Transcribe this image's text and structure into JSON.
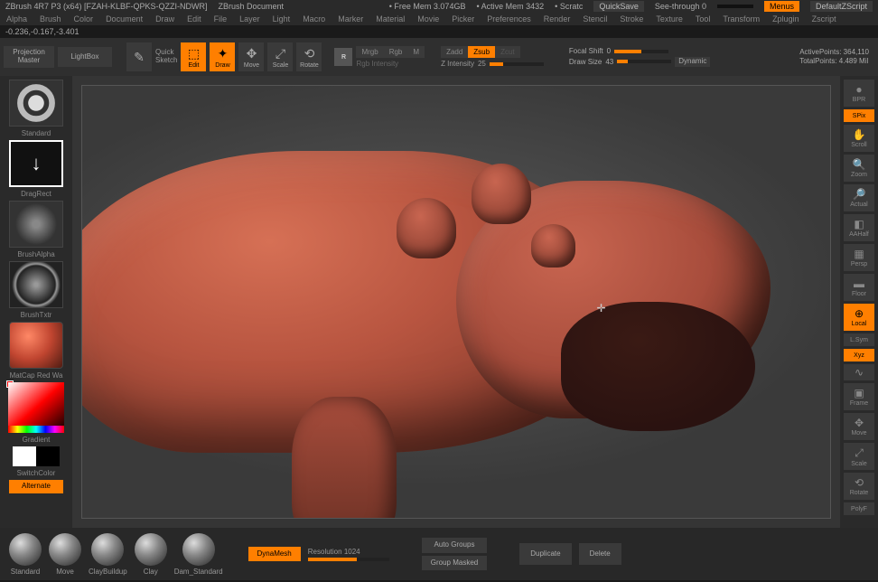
{
  "titlebar": {
    "app": "ZBrush 4R7 P3  (x64) [FZAH-KLBF-QPKS-QZZI-NDWR]",
    "doc": "ZBrush Document",
    "freemem_label": "Free Mem",
    "freemem": "3.074GB",
    "activemem_label": "Active Mem",
    "activemem": "3432",
    "scratch_label": "Scratc",
    "quicksave": "QuickSave",
    "seethrough_label": "See-through",
    "seethrough_val": "0",
    "menus": "Menus",
    "zscript": "DefaultZScript"
  },
  "menu": [
    "Alpha",
    "Brush",
    "Color",
    "Document",
    "Draw",
    "Edit",
    "File",
    "Layer",
    "Light",
    "Macro",
    "Marker",
    "Material",
    "Movie",
    "Picker",
    "Preferences",
    "Render",
    "Stencil",
    "Stroke",
    "Texture",
    "Tool",
    "Transform",
    "Zplugin",
    "Zscript"
  ],
  "coords": "-0.236,-0.167,-3.401",
  "toolbar": {
    "projection": "Projection\nMaster",
    "lightbox": "LightBox",
    "quicksketch": "Quick\nSketch",
    "edit": "Edit",
    "draw": "Draw",
    "move": "Move",
    "scale": "Scale",
    "rotate": "Rotate",
    "mrgb": "Mrgb",
    "rgb": "Rgb",
    "m": "M",
    "rgb_int_label": "Rgb Intensity",
    "zadd": "Zadd",
    "zsub": "Zsub",
    "zcut": "Zcut",
    "zint_label": "Z Intensity",
    "zint_val": "25",
    "focal_label": "Focal Shift",
    "focal_val": "0",
    "drawsize_label": "Draw Size",
    "drawsize_val": "43",
    "dynamic": "Dynamic",
    "activepoints_label": "ActivePoints:",
    "activepoints": "364,110",
    "totalpoints_label": "TotalPoints:",
    "totalpoints": "4.489 Mil"
  },
  "left": {
    "standard": "Standard",
    "dragrect": "DragRect",
    "brushalpha": "BrushAlpha",
    "brushtxtr": "BrushTxtr",
    "matcap": "MatCap Red Wa",
    "gradient": "Gradient",
    "switchcolor": "SwitchColor",
    "alternate": "Alternate"
  },
  "right": {
    "bpr": "BPR",
    "spix": "SPix",
    "scroll": "Scroll",
    "zoom": "Zoom",
    "actual": "Actual",
    "aahalf": "AAHalf",
    "persp": "Persp",
    "floor": "Floor",
    "local": "Local",
    "lsym": "L.Sym",
    "xyz": "Xyz",
    "frame": "Frame",
    "move": "Move",
    "scale": "Scale",
    "rotate": "Rotate",
    "polyf": "PolyF"
  },
  "bottom": {
    "brushes": [
      "Standard",
      "Move",
      "ClayBuildup",
      "Clay",
      "Dam_Standard"
    ],
    "dynamesh": "DynaMesh",
    "resolution_label": "Resolution",
    "resolution_val": "1024",
    "autogroups": "Auto Groups",
    "groupmasked": "Group Masked",
    "duplicate": "Duplicate",
    "delete": "Delete"
  }
}
